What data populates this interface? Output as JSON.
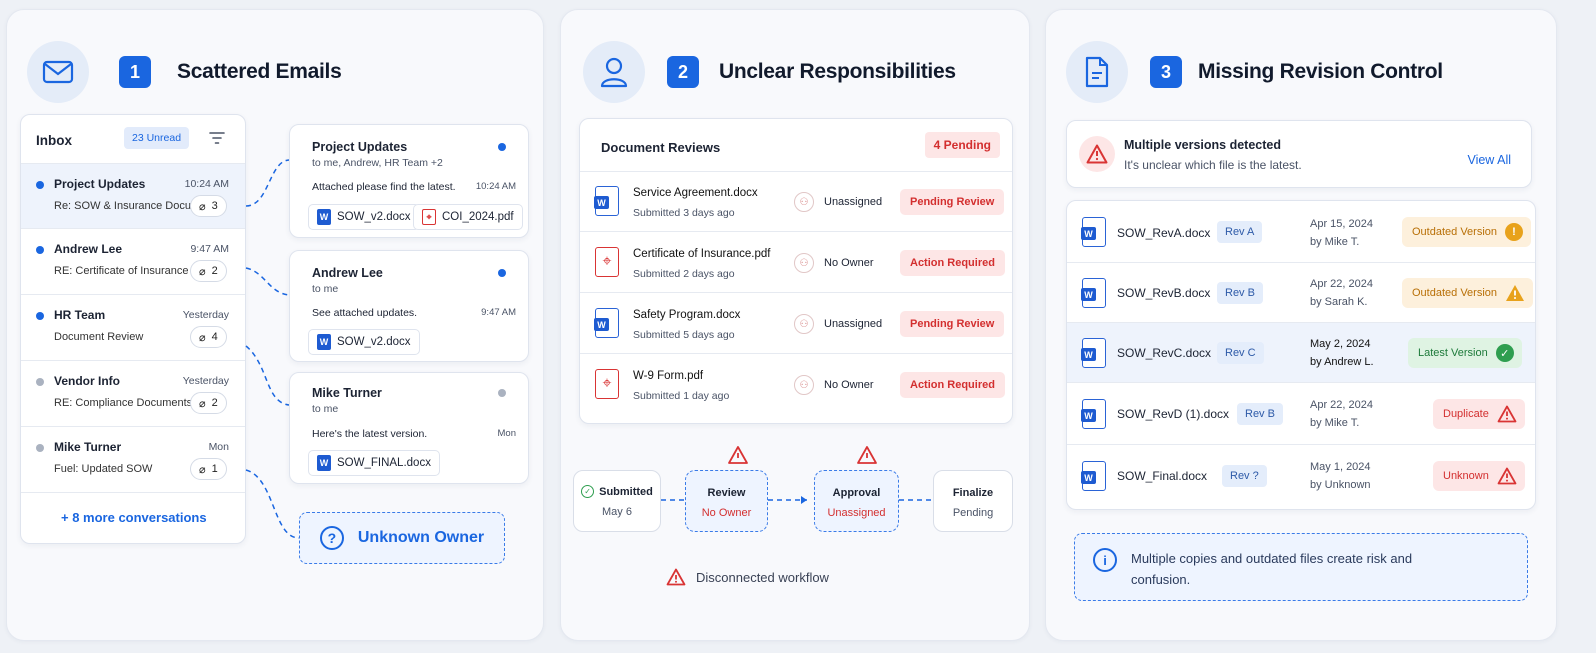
{
  "colors": {
    "accent": "#1a66e0",
    "danger": "#d32f2f",
    "warning": "#e8a21b",
    "success": "#2e9e4f"
  },
  "panel1": {
    "number": "1",
    "title": "Scattered Emails",
    "icon": "mail-icon",
    "inbox": {
      "title": "Inbox",
      "unread": "23 Unread",
      "items": [
        {
          "name": "Project Updates",
          "subject": "Re: SOW & Insurance Docu",
          "time": "10:24 AM",
          "count": "3",
          "unread": true
        },
        {
          "name": "Andrew Lee",
          "subject": "RE: Certificate of Insurance",
          "time": "9:47 AM",
          "count": "2",
          "unread": true
        },
        {
          "name": "HR Team",
          "subject": "Document Review",
          "time": "Yesterday",
          "count": "4",
          "unread": true
        },
        {
          "name": "Vendor Info",
          "subject": "RE: Compliance Documents",
          "time": "Yesterday",
          "count": "2",
          "unread": false
        },
        {
          "name": "Mike Turner",
          "subject": "Fuel: Updated SOW",
          "time": "Mon",
          "count": "1",
          "unread": false
        }
      ],
      "more": "+ 8 more conversations"
    },
    "messages": [
      {
        "from": "Project Updates",
        "to": "to me, Andrew, HR Team +2",
        "body": "Attached please find the latest.",
        "time": "10:24 AM",
        "attachments": [
          "SOW_v2.docx",
          "COI_2024.pdf"
        ]
      },
      {
        "from": "Andrew Lee",
        "to": "to me",
        "body": "See attached updates.",
        "time": "9:47 AM",
        "attachments": [
          "SOW_v2.docx"
        ]
      },
      {
        "from": "Mike Turner",
        "to": "to me",
        "body": "Here's the latest version.",
        "time": "Mon",
        "attachments": [
          "SOW_FINAL.docx"
        ]
      }
    ],
    "unknown_owner": "Unknown Owner"
  },
  "panel2": {
    "number": "2",
    "title": "Unclear Responsibilities",
    "icon": "user-icon",
    "reviews_title": "Document Reviews",
    "pending": "4 Pending",
    "docs": [
      {
        "name": "Service Agreement.docx",
        "submitted": "Submitted 3 days ago",
        "owner": "Unassigned",
        "status": "Pending Review",
        "type": "docx"
      },
      {
        "name": "Certificate of Insurance.pdf",
        "submitted": "Submitted 2 days ago",
        "owner": "No Owner",
        "status": "Action Required",
        "type": "pdf"
      },
      {
        "name": "Safety Program.docx",
        "submitted": "Submitted 5 days ago",
        "owner": "Unassigned",
        "status": "Pending Review",
        "type": "docx"
      },
      {
        "name": "W-9 Form.pdf",
        "submitted": "Submitted 1 day ago",
        "owner": "No Owner",
        "status": "Action Required",
        "type": "pdf"
      }
    ],
    "workflow": [
      {
        "title": "Submitted",
        "sub": "May 6"
      },
      {
        "title": "Review",
        "sub": "No Owner"
      },
      {
        "title": "Approval",
        "sub": "Unassigned"
      },
      {
        "title": "Finalize",
        "sub": "Pending"
      }
    ],
    "workflow_note": "Disconnected workflow"
  },
  "panel3": {
    "number": "3",
    "title": "Missing Revision Control",
    "icon": "document-icon",
    "alert_title": "Multiple versions detected",
    "alert_text": "It's unclear which file is the latest.",
    "view_all": "View All",
    "files": [
      {
        "name": "SOW_RevA.docx",
        "rev": "Rev A",
        "date": "Apr 15, 2024",
        "by": "by Mike T.",
        "status": "Outdated Version",
        "kind": "warning-circle"
      },
      {
        "name": "SOW_RevB.docx",
        "rev": "Rev B",
        "date": "Apr 22, 2024",
        "by": "by Sarah K.",
        "status": "Outdated Version",
        "kind": "warning-triangle"
      },
      {
        "name": "SOW_RevC.docx",
        "rev": "Rev C",
        "date": "May 2, 2024",
        "by": "by Andrew L.",
        "status": "Latest Version",
        "kind": "success"
      },
      {
        "name": "SOW_RevD (1).docx",
        "rev": "Rev B",
        "date": "Apr 22, 2024",
        "by": "by Mike T.",
        "status": "Duplicate",
        "kind": "danger"
      },
      {
        "name": "SOW_Final.docx",
        "rev": "Rev ?",
        "date": "May 1, 2024",
        "by": "by Unknown",
        "status": "Unknown",
        "kind": "danger"
      }
    ],
    "note": "Multiple copies and outdated files create risk and confusion."
  }
}
